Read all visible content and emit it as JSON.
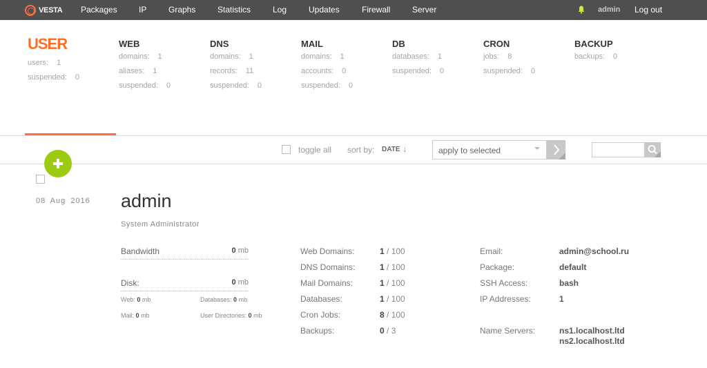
{
  "topnav": {
    "logo_text": "VESTA",
    "items": [
      "Packages",
      "IP",
      "Graphs",
      "Statistics",
      "Log",
      "Updates",
      "Firewall",
      "Server"
    ],
    "user": "admin",
    "logout": "Log out"
  },
  "stats": {
    "user": {
      "title": "USER",
      "rows": [
        {
          "label": "users:",
          "value": "1"
        },
        {
          "label": "suspended:",
          "value": "0"
        }
      ]
    },
    "web": {
      "title": "WEB",
      "rows": [
        {
          "label": "domains:",
          "value": "1"
        },
        {
          "label": "aliases:",
          "value": "1"
        },
        {
          "label": "suspended:",
          "value": "0"
        }
      ]
    },
    "dns": {
      "title": "DNS",
      "rows": [
        {
          "label": "domains:",
          "value": "1"
        },
        {
          "label": "records:",
          "value": "11"
        },
        {
          "label": "suspended:",
          "value": "0"
        }
      ]
    },
    "mail": {
      "title": "MAIL",
      "rows": [
        {
          "label": "domains:",
          "value": "1"
        },
        {
          "label": "accounts:",
          "value": "0"
        },
        {
          "label": "suspended:",
          "value": "0"
        }
      ]
    },
    "db": {
      "title": "DB",
      "rows": [
        {
          "label": "databases:",
          "value": "1"
        },
        {
          "label": "suspended:",
          "value": "0"
        }
      ]
    },
    "cron": {
      "title": "CRON",
      "rows": [
        {
          "label": "jobs:",
          "value": "8"
        },
        {
          "label": "suspended:",
          "value": "0"
        }
      ]
    },
    "backup": {
      "title": "BACKUP",
      "rows": [
        {
          "label": "backups:",
          "value": "0"
        }
      ]
    }
  },
  "toolbar": {
    "toggle_all": "toggle all",
    "sort_label": "sort by:",
    "sort_value": "DATE",
    "sort_arrow": "↓",
    "action_select": "apply to selected"
  },
  "record": {
    "date": "08 Aug 2016",
    "name": "admin",
    "role": "System Administrator",
    "bandwidth": {
      "label": "Bandwidth",
      "value": "0",
      "unit": "mb"
    },
    "disk": {
      "label": "Disk:",
      "value": "0",
      "unit": "mb"
    },
    "disk_breakdown": {
      "web": {
        "label": "Web:",
        "value": "0",
        "unit": "mb"
      },
      "databases": {
        "label": "Databases:",
        "value": "0",
        "unit": "mb"
      },
      "mail": {
        "label": "Mail:",
        "value": "0",
        "unit": "mb"
      },
      "user_dirs": {
        "label": "User Directories:",
        "value": "0",
        "unit": "mb"
      }
    },
    "limits": [
      {
        "label": "Web Domains:",
        "used": "1",
        "limit": "/ 100"
      },
      {
        "label": "DNS Domains:",
        "used": "1",
        "limit": "/ 100"
      },
      {
        "label": "Mail Domains:",
        "used": "1",
        "limit": "/ 100"
      },
      {
        "label": "Databases:",
        "used": "1",
        "limit": "/ 100"
      },
      {
        "label": "Cron Jobs:",
        "used": "8",
        "limit": "/ 100"
      },
      {
        "label": "Backups:",
        "used": "0",
        "limit": "/ 3"
      }
    ],
    "info": {
      "email": {
        "label": "Email:",
        "value": "admin@school.ru"
      },
      "package": {
        "label": "Package:",
        "value": "default"
      },
      "ssh": {
        "label": "SSH Access:",
        "value": "bash"
      },
      "ip": {
        "label": "IP Addresses:",
        "value": "1"
      },
      "ns": {
        "label": "Name Servers:",
        "value1": "ns1.localhost.ltd",
        "value2": "ns2.localhost.ltd"
      }
    }
  },
  "colors": {
    "accent": "#ff6e42",
    "nav_bg": "#4f4f4f",
    "add_button": "#9ccb12"
  }
}
